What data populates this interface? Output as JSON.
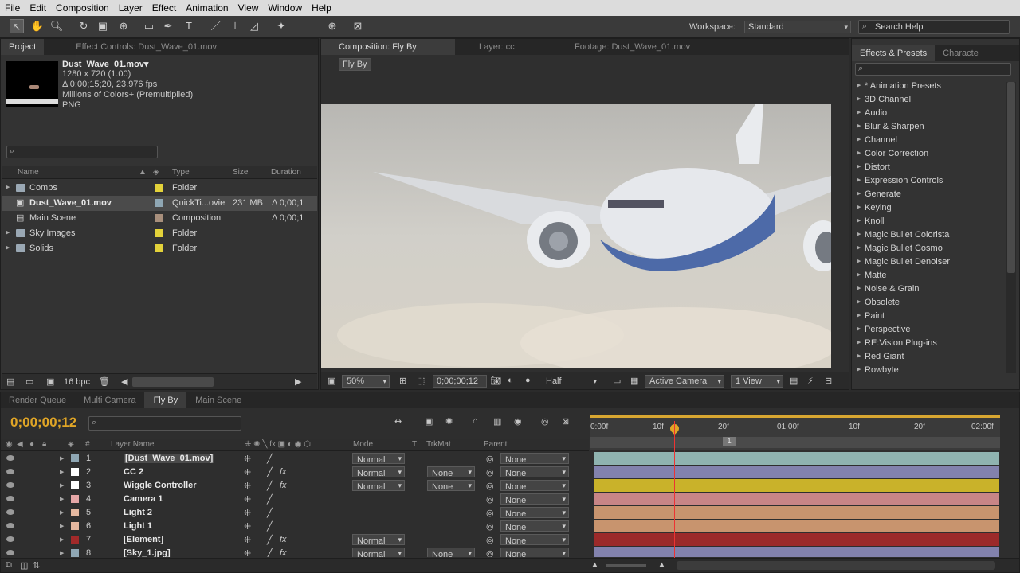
{
  "menu": [
    "File",
    "Edit",
    "Composition",
    "Layer",
    "Effect",
    "Animation",
    "View",
    "Window",
    "Help"
  ],
  "workspace": {
    "label": "Workspace:",
    "value": "Standard",
    "search_placeholder": "Search Help"
  },
  "project": {
    "tabs": [
      "Project",
      "Effect Controls: Dust_Wave_01.mov"
    ],
    "file_name": "Dust_Wave_01.mov▾",
    "file_info": [
      "1280 x 720 (1.00)",
      "Δ 0;00;15;20, 23.976 fps",
      "Millions of Colors+ (Premultiplied)",
      "PNG"
    ],
    "columns": [
      "Name",
      "Type",
      "Size",
      "Duration"
    ],
    "items": [
      {
        "name": "Comps",
        "type": "Folder",
        "size": "",
        "duration": "",
        "color": "#e3d23a",
        "kind": "folder"
      },
      {
        "name": "Dust_Wave_01.mov",
        "type": "QuickTi...ovie",
        "size": "231 MB",
        "duration": "Δ 0;00;1",
        "color": "#8fa7b4",
        "kind": "footage"
      },
      {
        "name": "Main Scene",
        "type": "Composition",
        "size": "",
        "duration": "Δ 0;00;1",
        "color": "#a88f7c",
        "kind": "comp"
      },
      {
        "name": "Sky Images",
        "type": "Folder",
        "size": "",
        "duration": "",
        "color": "#e3d23a",
        "kind": "folder"
      },
      {
        "name": "Solids",
        "type": "Folder",
        "size": "",
        "duration": "",
        "color": "#e3d23a",
        "kind": "folder"
      }
    ],
    "bpc": "16 bpc"
  },
  "composition": {
    "tabs": [
      "Composition: Fly By",
      "Layer: cc",
      "Footage: Dust_Wave_01.mov"
    ],
    "breadcrumb": "Fly By",
    "zoom": "50%",
    "timecode": "0;00;00;12",
    "resolution": "Half",
    "camera": "Active Camera",
    "views": "1 View"
  },
  "effects": {
    "tabs": [
      "Effects & Presets",
      "Characte"
    ],
    "items": [
      "* Animation Presets",
      "3D Channel",
      "Audio",
      "Blur & Sharpen",
      "Channel",
      "Color Correction",
      "Distort",
      "Expression Controls",
      "Generate",
      "Keying",
      "Knoll",
      "Magic Bullet Colorista",
      "Magic Bullet Cosmo",
      "Magic Bullet Denoiser",
      "Matte",
      "Noise & Grain",
      "Obsolete",
      "Paint",
      "Perspective",
      "RE:Vision Plug-ins",
      "Red Giant",
      "Rowbyte"
    ]
  },
  "timeline": {
    "tabs": [
      "Render Queue",
      "Multi Camera",
      "Fly By",
      "Main Scene"
    ],
    "timecode": "0;00;00;12",
    "columns": {
      "num": "#",
      "layer": "Layer Name",
      "mode": "Mode",
      "t": "T",
      "trkmat": "TrkMat",
      "parent": "Parent"
    },
    "ruler": [
      "0:00f",
      "10f",
      "20f",
      "01:00f",
      "10f",
      "20f",
      "02:00f"
    ],
    "marker": "1",
    "layers": [
      {
        "num": "1",
        "name": "[Dust_Wave_01.mov]",
        "color": "#8fa7b4",
        "mode": "Normal",
        "trkmat": "",
        "parent": "None",
        "bar": "#8fb3b0",
        "fx": false,
        "selected": true
      },
      {
        "num": "2",
        "name": "CC 2",
        "color": "#ffffff",
        "mode": "Normal",
        "trkmat": "None",
        "parent": "None",
        "bar": "#8282ad",
        "fx": true,
        "selected": false
      },
      {
        "num": "3",
        "name": "Wiggle Controller",
        "color": "#ffffff",
        "mode": "Normal",
        "trkmat": "None",
        "parent": "None",
        "bar": "#c9b22a",
        "fx": true,
        "selected": false
      },
      {
        "num": "4",
        "name": "Camera 1",
        "color": "#e5a6a6",
        "mode": "",
        "trkmat": "",
        "parent": "None",
        "bar": "#c88586",
        "fx": false,
        "selected": false
      },
      {
        "num": "5",
        "name": "Light 2",
        "color": "#e5b8a0",
        "mode": "",
        "trkmat": "",
        "parent": "None",
        "bar": "#c8946e",
        "fx": false,
        "selected": false
      },
      {
        "num": "6",
        "name": "Light 1",
        "color": "#e5b8a0",
        "mode": "",
        "trkmat": "",
        "parent": "None",
        "bar": "#c8946e",
        "fx": false,
        "selected": false
      },
      {
        "num": "7",
        "name": "[Element]",
        "color": "#a12a2a",
        "mode": "Normal",
        "trkmat": "",
        "parent": "None",
        "bar": "#9b2a2a",
        "fx": true,
        "selected": false
      },
      {
        "num": "8",
        "name": "[Sky_1.jpg]",
        "color": "#8fa7b4",
        "mode": "Normal",
        "trkmat": "None",
        "parent": "None",
        "bar": "#8282ad",
        "fx": true,
        "selected": false
      }
    ]
  }
}
